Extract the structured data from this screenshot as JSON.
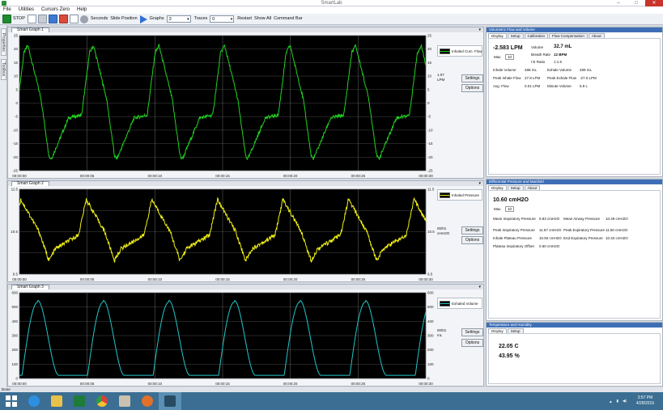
{
  "window": {
    "title": "SmartLab"
  },
  "menu": [
    "File",
    "Utilities",
    "Cursors Zero",
    "Help"
  ],
  "toolbar": {
    "stop_label": "STOP",
    "seconds_label": "Seconds",
    "slide_label": "Slide Position",
    "graphs_label": "Graphs",
    "graphs_value": "3",
    "traces_label": "Traces",
    "traces_value": "0",
    "restart_label": "Restart",
    "show_all_label": "Show All",
    "command_bar_label": "Command Bar"
  },
  "left_dock": {
    "tab1": "Properties",
    "tab2": "Toolbox"
  },
  "graphs": [
    {
      "tab": "Smart Graph 1",
      "legend": "Inhaled Cum. Flow",
      "value": "1.07",
      "unit": "LPM",
      "settings": "Settings",
      "options": "Options",
      "color": "#21d321",
      "y_left_ticks": [
        "25",
        "20",
        "15",
        "10",
        "5",
        "0",
        "-5",
        "-10",
        "-15",
        "-20",
        "-25"
      ],
      "y_right_ticks": [
        "25",
        "20",
        "15",
        "10",
        "5",
        "0",
        "-5",
        "-10",
        "-15",
        "-20",
        "-25"
      ],
      "x_ticks": [
        "00:00:00",
        "00:00:05",
        "00:00:10",
        "00:00:15",
        "00:00:20",
        "00:00:25",
        "00:00:30"
      ]
    },
    {
      "tab": "Smart Graph 2",
      "legend": "Inhaled Pressure",
      "value": "00/01",
      "unit": "cmH2O",
      "settings": "Settings",
      "options": "Options",
      "color": "#f2f215",
      "y_left_ticks": [
        "11.5",
        "",
        "10.5",
        "",
        "9.5"
      ],
      "y_right_ticks": [
        "11.5",
        "",
        "10.5",
        "",
        "9.5"
      ],
      "x_ticks": [
        "00:00:00",
        "00:00:05",
        "00:00:10",
        "00:00:15",
        "00:00:20",
        "00:00:25",
        "00:00:30"
      ]
    },
    {
      "tab": "Smart Graph 3",
      "legend": "Exhaled Volume",
      "value": "00/01",
      "unit": "mL",
      "settings": "Settings",
      "options": "Options",
      "color": "#22c7c9",
      "y_left_ticks": [
        "600",
        "500",
        "400",
        "300",
        "200",
        "100",
        "0"
      ],
      "y_right_ticks": [
        "600",
        "500",
        "400",
        "300",
        "200",
        "100",
        "0"
      ],
      "x_ticks": [
        "00:00:00",
        "00:00:05",
        "00:00:10",
        "00:00:15",
        "00:00:20",
        "00:00:25",
        "00:00:30"
      ]
    }
  ],
  "panels": [
    {
      "title": "Volumetric Flow and Volume",
      "tabs": [
        "Display",
        "Setup",
        "Calibration",
        "Flow Compensation",
        "About"
      ],
      "main_value": "-2.583 LPM",
      "max_label": "Max",
      "max_value": "10",
      "rows": [
        {
          "l": "Volume",
          "v": "32.7 mL"
        },
        {
          "l": "Breath Rate",
          "v": "12 BPM"
        },
        {
          "l": "I:E Ratio",
          "v": "1:1.5"
        },
        {
          "l": "Inhale Volume",
          "v": "488 mL"
        },
        {
          "l": "Exhale Volume",
          "v": "489 mL"
        },
        {
          "l": "Peak Inhale Flow",
          "v": "27.8 LPM"
        },
        {
          "l": "Peak Exhale Flow",
          "v": "-27.0 LPM"
        },
        {
          "l": "Avg. Flow",
          "v": "0.01 LPM"
        },
        {
          "l": "Minute Volume",
          "v": "5.9 L"
        }
      ]
    },
    {
      "title": "Differential Pressure and Manifold",
      "tabs": [
        "Display",
        "Setup",
        "About"
      ],
      "main_value": "10.60 cmH2O",
      "max_label": "Max",
      "max_value": "10",
      "rows": [
        {
          "l": "Mean Inspiratory Pressure",
          "v": "9.83 cmH2O"
        },
        {
          "l": "Mean Airway Pressure",
          "v": "10.49 cmH2O"
        },
        {
          "l": "Peak Inspiratory Pressure",
          "v": "11.57 cmH2O"
        },
        {
          "l": "Peak Expiratory Pressure",
          "v": "11.60 cmH2O"
        },
        {
          "l": "Inhale Plateau Pressure",
          "v": "10.50 cmH2O"
        },
        {
          "l": "End Expiratory Pressure",
          "v": "10.34 cmH2O"
        },
        {
          "l": "Plateau Inspiratory Offset",
          "v": "0.60 cmH2O"
        }
      ]
    },
    {
      "title": "Temperature and Humidity",
      "tabs": [
        "Display",
        "Setup"
      ],
      "temp": "22.05 C",
      "humidity": "43.95 %"
    }
  ],
  "status": "Done",
  "taskbar": {
    "time": "3:57 PM",
    "date": "4/28/2015",
    "apps": [
      "start-icon",
      "ie-icon",
      "explorer-icon",
      "excel-icon",
      "chrome-icon",
      "paint-icon",
      "firefox-icon",
      "smartlab-icon"
    ]
  }
}
